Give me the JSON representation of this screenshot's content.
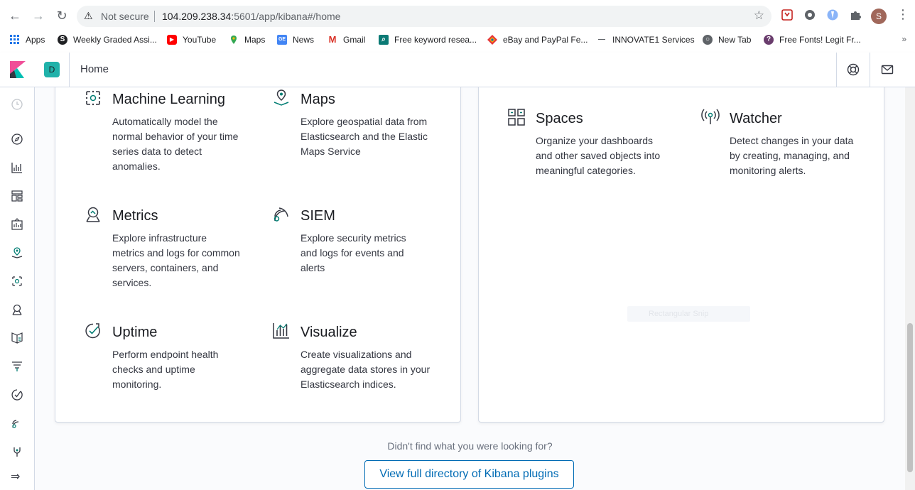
{
  "browser": {
    "security_label": "Not secure",
    "url_host": "104.209.238.34",
    "url_rest": ":5601/app/kibana#/home",
    "profile_initial": "S"
  },
  "bookmarks": [
    {
      "label": "Apps",
      "icon": "apps-grid-icon",
      "color": "#1a73e8"
    },
    {
      "label": "Weekly Graded Assi...",
      "icon": "s-circle-icon",
      "color": "#202124"
    },
    {
      "label": "YouTube",
      "icon": "youtube-icon",
      "color": "#ff0000"
    },
    {
      "label": "Maps",
      "icon": "maps-pin-icon",
      "color": "#34a853"
    },
    {
      "label": "News",
      "icon": "news-icon",
      "color": "#4285f4"
    },
    {
      "label": "Gmail",
      "icon": "gmail-icon",
      "color": "#d93025"
    },
    {
      "label": "Free keyword resea...",
      "icon": "keyword-icon",
      "color": "#0b7a75"
    },
    {
      "label": "eBay and PayPal Fe...",
      "icon": "ebay-icon",
      "color": "#e53238"
    },
    {
      "label": "INNOVATE1 Services",
      "icon": "dash-icon",
      "color": "#5f6368"
    },
    {
      "label": "New Tab",
      "icon": "globe-icon",
      "color": "#5f6368"
    },
    {
      "label": "Free Fonts! Legit Fr...",
      "icon": "fonts-icon",
      "color": "#6a3d6d"
    }
  ],
  "header": {
    "space_initial": "D",
    "title": "Home"
  },
  "features_left": [
    {
      "title": "Machine Learning",
      "desc": "Automatically model the normal behavior of your time series data to detect anomalies.",
      "icon": "machine-learning-icon"
    },
    {
      "title": "Maps",
      "desc": "Explore geospatial data from Elasticsearch and the Elastic Maps Service",
      "icon": "maps-icon"
    },
    {
      "title": "Metrics",
      "desc": "Explore infrastructure metrics and logs for common servers, containers, and services.",
      "icon": "metrics-icon"
    },
    {
      "title": "SIEM",
      "desc": "Explore security metrics and logs for events and alerts",
      "icon": "siem-icon"
    },
    {
      "title": "Uptime",
      "desc": "Perform endpoint health checks and uptime monitoring.",
      "icon": "uptime-icon"
    },
    {
      "title": "Visualize",
      "desc": "Create visualizations and aggregate data stores in your Elasticsearch indices.",
      "icon": "visualize-icon"
    }
  ],
  "features_right": [
    {
      "title": "Spaces",
      "desc": "Organize your dashboards and other saved objects into meaningful categories.",
      "icon": "spaces-icon"
    },
    {
      "title": "Watcher",
      "desc": "Detect changes in your data by creating, managing, and monitoring alerts.",
      "icon": "watcher-icon"
    }
  ],
  "footer": {
    "not_found_text": "Didn't find what you were looking for?",
    "directory_button": "View full directory of Kibana plugins"
  },
  "ghost_label": "Rectangular Snip",
  "colors": {
    "accent": "#006bb4",
    "teal": "#20b2aa",
    "text": "#1a1c21"
  }
}
